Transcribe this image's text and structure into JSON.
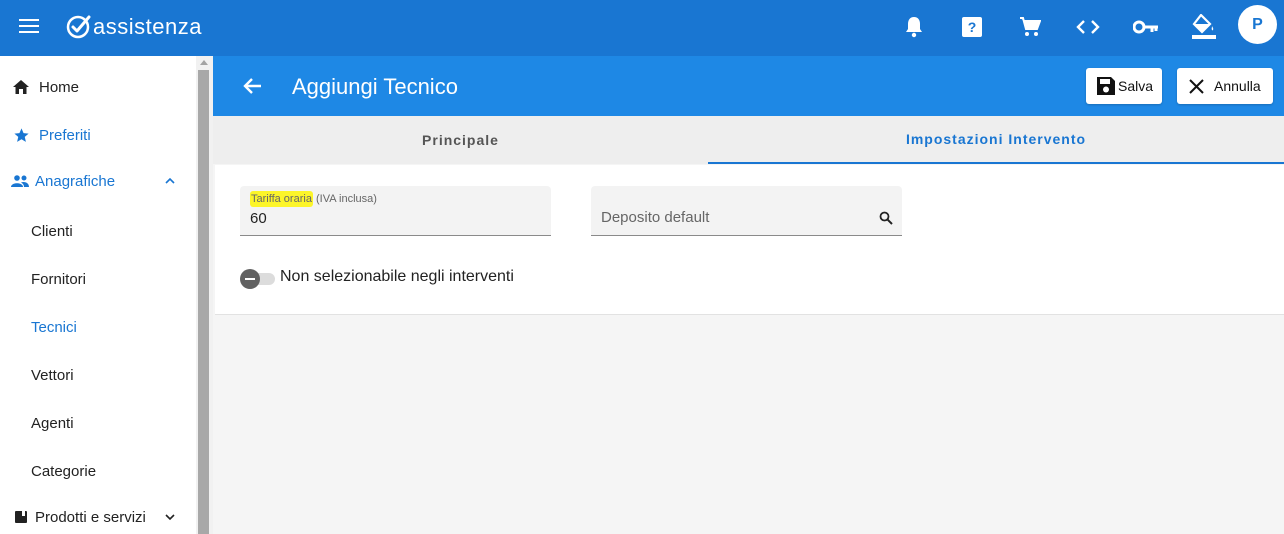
{
  "app": {
    "brand": "assistenza",
    "menu_icon": "hamburger-icon",
    "user_initial": "P"
  },
  "topbar_icons": [
    "bell-icon",
    "help-icon",
    "cart-icon",
    "code-icon",
    "key-icon",
    "paint-bucket-icon"
  ],
  "sidebar": {
    "items": [
      {
        "label": "Home",
        "icon": "home-icon"
      },
      {
        "label": "Preferiti",
        "icon": "star-icon"
      },
      {
        "label": "Anagrafiche",
        "icon": "people-icon"
      },
      {
        "label": "Clienti"
      },
      {
        "label": "Fornitori"
      },
      {
        "label": "Tecnici"
      },
      {
        "label": "Vettori"
      },
      {
        "label": "Agenti"
      },
      {
        "label": "Categorie"
      },
      {
        "label": "Prodotti e servizi",
        "icon": "book-icon"
      }
    ]
  },
  "header": {
    "title": "Aggiungi Tecnico",
    "save_label": "Salva",
    "cancel_label": "Annulla"
  },
  "tabs": [
    {
      "label": "Principale"
    },
    {
      "label": "Impostazioni Intervento"
    }
  ],
  "form": {
    "rate_label_highlight": "Tariffa oraria",
    "rate_label_suffix": " (IVA inclusa)",
    "rate_value": "60",
    "deposit_placeholder": "Deposito default",
    "toggle_label": "Non selezionabile negli interventi"
  },
  "colors": {
    "primary": "#1976d2",
    "header": "#1e88e5",
    "highlight": "#fcf529"
  }
}
